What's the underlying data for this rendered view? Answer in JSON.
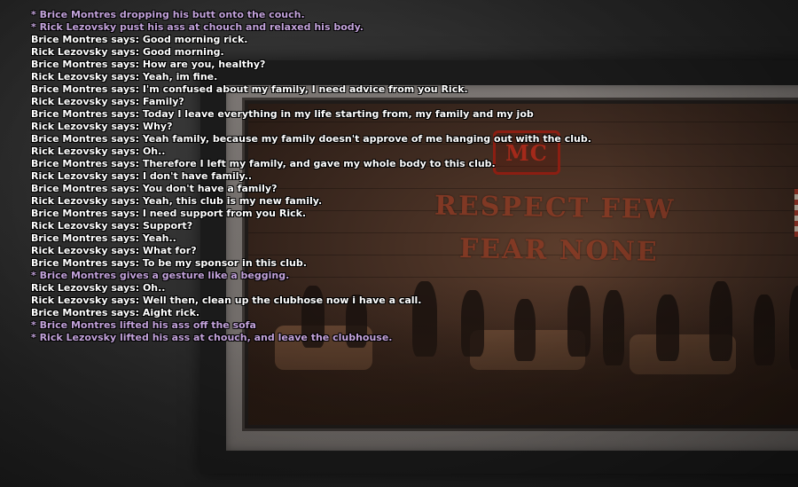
{
  "colors": {
    "chat_text": "#ffffff",
    "action_text": "#c2a2da",
    "sign_red": "#a3291a",
    "wall_text": "#8a3a24"
  },
  "scene": {
    "sign_text": "MC",
    "wall_text_line1": "RESPECT FEW",
    "wall_text_line2": "FEAR NONE"
  },
  "chat": {
    "lines": [
      {
        "type": "action",
        "text": "* Brice Montres dropping his butt onto the couch."
      },
      {
        "type": "action",
        "text": "* Rick Lezovsky pust his ass at chouch and relaxed his body."
      },
      {
        "type": "say",
        "text": "Brice Montres says: Good morning rick."
      },
      {
        "type": "say",
        "text": "Rick Lezovsky says: Good morning."
      },
      {
        "type": "say",
        "text": "Brice Montres says: How are you, healthy?"
      },
      {
        "type": "say",
        "text": "Rick Lezovsky says: Yeah, im fine."
      },
      {
        "type": "say",
        "text": "Brice Montres says: I'm confused about my family, I need advice from you Rick."
      },
      {
        "type": "say",
        "text": "Rick Lezovsky says: Family?"
      },
      {
        "type": "say",
        "text": "Brice Montres says: Today I leave everything in my life starting from, my family and my job"
      },
      {
        "type": "say",
        "text": "Rick Lezovsky says: Why?"
      },
      {
        "type": "say",
        "text": "Brice Montres says: Yeah family, because my family doesn't approve of me hanging out with the club."
      },
      {
        "type": "say",
        "text": "Rick Lezovsky says: Oh.."
      },
      {
        "type": "say",
        "text": "Brice Montres says: Therefore I left my family, and gave my whole body to this club."
      },
      {
        "type": "say",
        "text": "Rick Lezovsky says: I don't have family.."
      },
      {
        "type": "say",
        "text": "Brice Montres says: You don't have a family?"
      },
      {
        "type": "say",
        "text": "Rick Lezovsky says: Yeah, this club is my new family."
      },
      {
        "type": "say",
        "text": "Brice Montres says: I need support from you Rick."
      },
      {
        "type": "say",
        "text": "Rick Lezovsky says: Support?"
      },
      {
        "type": "say",
        "text": "Brice Montres says: Yeah.."
      },
      {
        "type": "say",
        "text": "Rick Lezovsky says: What for?"
      },
      {
        "type": "say",
        "text": "Brice Montres says: To be my sponsor in this club."
      },
      {
        "type": "action",
        "text": "* Brice Montres gives a gesture like a begging."
      },
      {
        "type": "say",
        "text": "Rick Lezovsky says: Oh.."
      },
      {
        "type": "say",
        "text": "Rick Lezovsky says: Well then, clean up the clubhose now i have a call."
      },
      {
        "type": "say",
        "text": "Brice Montres says: Aight rick."
      },
      {
        "type": "action",
        "text": "* Brice Montres lifted his ass off the sofa"
      },
      {
        "type": "action",
        "text": "* Rick Lezovsky lifted his ass at chouch, and leave the clubhouse."
      }
    ]
  }
}
